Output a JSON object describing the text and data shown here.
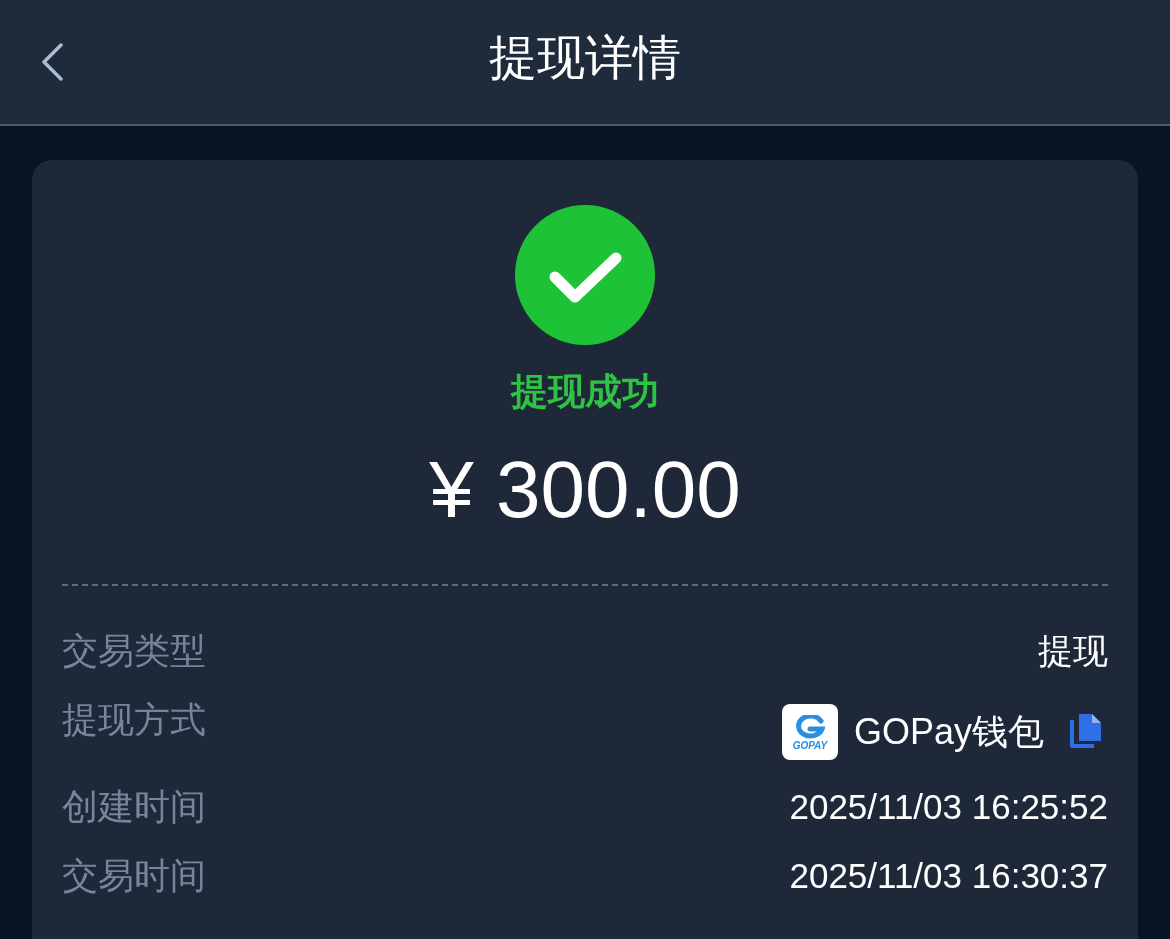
{
  "header": {
    "title": "提现详情"
  },
  "status": {
    "kind": "success",
    "text": "提现成功"
  },
  "amount": "¥ 300.00",
  "details": [
    {
      "kind": "text",
      "label": "交易类型",
      "value": "提现"
    },
    {
      "kind": "method",
      "label": "提现方式",
      "value": "GOPay钱包",
      "logo_text": "GOPAY",
      "copyable": true
    },
    {
      "kind": "text",
      "label": "创建时间",
      "value": "2025/11/03 16:25:52"
    },
    {
      "kind": "text",
      "label": "交易时间",
      "value": "2025/11/03 16:30:37"
    }
  ]
}
